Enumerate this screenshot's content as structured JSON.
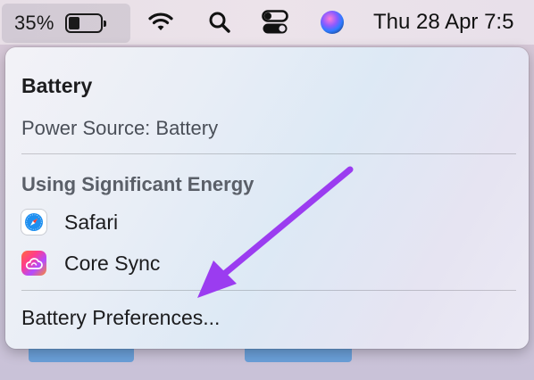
{
  "menubar": {
    "battery_percent": "35%",
    "battery_level": 0.35,
    "clock": "Thu 28 Apr  7:5"
  },
  "panel": {
    "title": "Battery",
    "power_source": "Power Source: Battery",
    "energy_heading": "Using Significant Energy",
    "apps": [
      {
        "label": "Safari",
        "icon": "safari-icon"
      },
      {
        "label": "Core Sync",
        "icon": "core-sync-icon"
      }
    ],
    "preferences_label": "Battery Preferences..."
  },
  "annotation": {
    "arrow_color": "#9b3cf0"
  },
  "colors": {
    "panel_text": "#1c1c1e",
    "secondary_text": "#4a4f58"
  }
}
